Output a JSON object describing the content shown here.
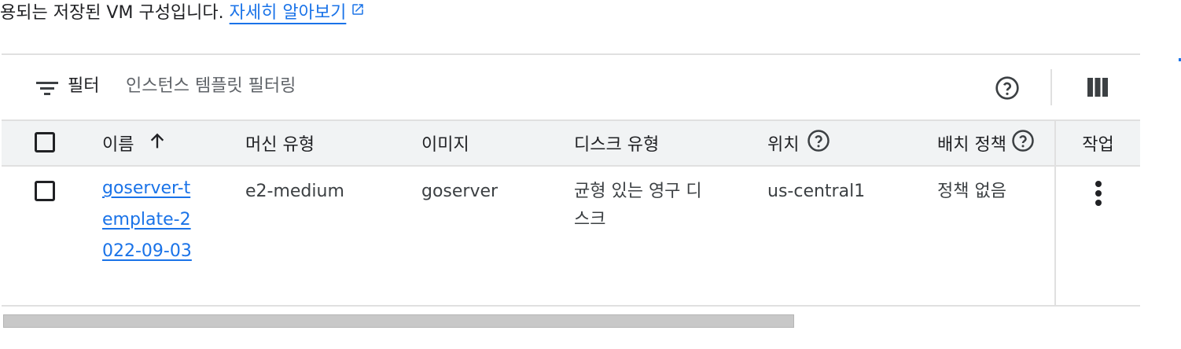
{
  "intro": {
    "text": "용되는 저장된 VM 구성입니다.",
    "learn_more": "자세히 알아보기"
  },
  "filter": {
    "label": "필터",
    "placeholder": "인스턴스 템플릿 필터링"
  },
  "table": {
    "headers": {
      "name": "이름",
      "machine_type": "머신 유형",
      "image": "이미지",
      "disk_type": "디스크 유형",
      "location": "위치",
      "placement_policy": "배치 정책",
      "actions": "작업"
    },
    "sort": {
      "column": "name",
      "direction": "ascending"
    },
    "rows": [
      {
        "name": "goserver-template-2022-09-03",
        "machine_type": "e2-medium",
        "image": "goserver",
        "disk_type": "균형 있는 영구 디스크",
        "location": "us-central1",
        "placement_policy": "정책 없음",
        "checked": false
      }
    ]
  },
  "icons": [
    "external-link-icon",
    "filter-icon",
    "help-icon",
    "column-display-icon",
    "sort-arrow-up-icon",
    "more-vert-icon"
  ],
  "colors": {
    "link": "#1a73e8",
    "header_bg": "#f1f3f4",
    "border": "#e0e0e0",
    "muted_text": "#5f6368"
  }
}
